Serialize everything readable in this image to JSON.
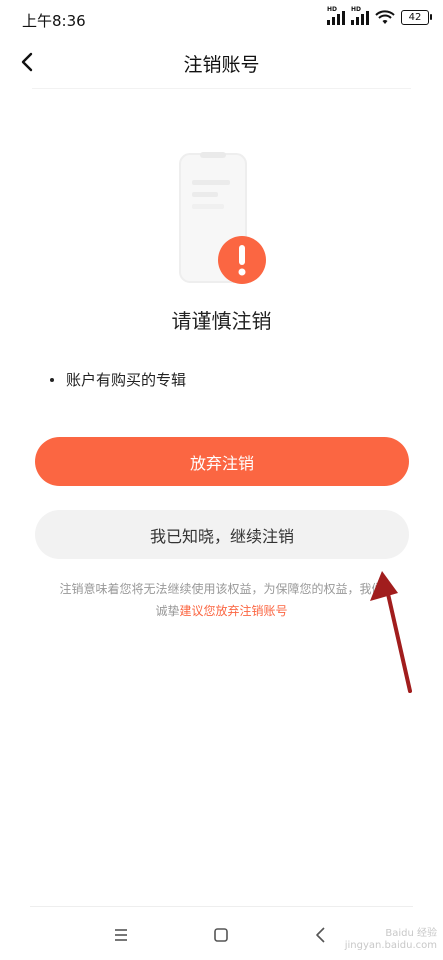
{
  "status_bar": {
    "time": "上午8:36",
    "signal_label": "HD",
    "battery": "42"
  },
  "header": {
    "title": "注销账号"
  },
  "warning": {
    "title": "请谨慎注销"
  },
  "reasons": [
    "账户有购买的专辑"
  ],
  "buttons": {
    "abandon_label": "放弃注销",
    "continue_label": "我已知晓，继续注销"
  },
  "notice": {
    "text_1": "注销意味着您将无法继续使用该权益，为保障您的权益，我们诚挚",
    "link": "建议您放弃注销账号"
  },
  "colors": {
    "accent": "#fb6642",
    "secondary_button_bg": "#f2f2f2",
    "annotation_arrow": "#a11d1d"
  },
  "icons": {
    "back": "chevron-left-icon",
    "warning": "exclamation-icon",
    "nav_menu": "menu-icon",
    "nav_home": "square-icon",
    "nav_back": "back-triangle-icon"
  },
  "watermark": {
    "line1": "Baidu 经验",
    "line2": "jingyan.baidu.com"
  }
}
